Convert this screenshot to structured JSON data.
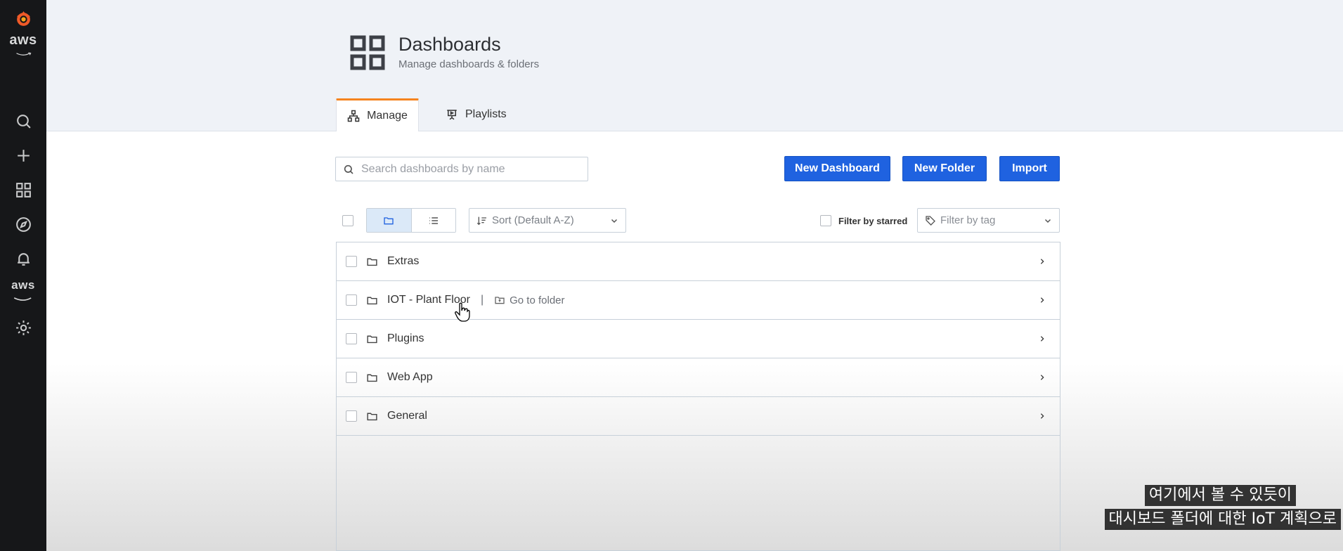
{
  "sidebar": {
    "logo_icon": "grafana-logo-icon",
    "aws_top_label": "aws",
    "items": [
      {
        "icon": "search-icon"
      },
      {
        "icon": "plus-icon"
      },
      {
        "icon": "dashboards-icon"
      },
      {
        "icon": "explore-compass-icon"
      },
      {
        "icon": "bell-icon"
      },
      {
        "icon": "aws-icon",
        "label": "aws"
      },
      {
        "icon": "gear-icon"
      }
    ]
  },
  "header": {
    "title": "Dashboards",
    "subtitle": "Manage dashboards & folders",
    "tabs": [
      {
        "label": "Manage",
        "active": true
      },
      {
        "label": "Playlists",
        "active": false
      }
    ]
  },
  "toolbar": {
    "search_placeholder": "Search dashboards by name",
    "new_dashboard_label": "New Dashboard",
    "new_folder_label": "New Folder",
    "import_label": "Import"
  },
  "filters": {
    "sort_label": "Sort (Default A-Z)",
    "starred_label": "Filter by starred",
    "tag_placeholder": "Filter by tag"
  },
  "folders": [
    {
      "name": "Extras"
    },
    {
      "name": "IOT - Plant Floor",
      "goto_label": "Go to folder",
      "separator": "|"
    },
    {
      "name": "Plugins"
    },
    {
      "name": "Web App"
    },
    {
      "name": "General"
    }
  ],
  "subtitles": {
    "line1": "여기에서 볼 수 있듯이",
    "line2": "대시보드 폴더에 대한 IoT 계획으로"
  },
  "colors": {
    "accent": "#1f62e0",
    "tab_active": "#f5841f",
    "sidebar_bg": "#161719"
  }
}
